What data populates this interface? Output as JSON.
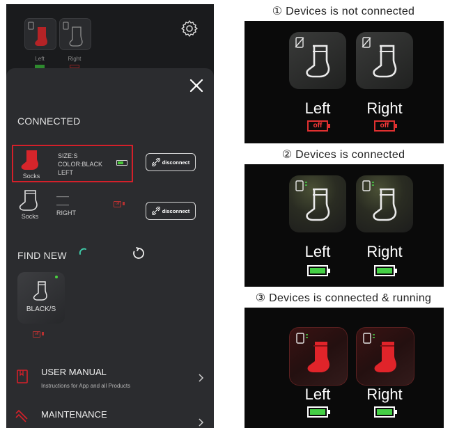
{
  "phone": {
    "top_devices": [
      {
        "label": "Left",
        "status": "connected"
      },
      {
        "label": "Right",
        "status": "off"
      }
    ],
    "connected_title": "CONNECTED",
    "connected_devices": [
      {
        "name": "Socks",
        "line1": "SIZE:S",
        "line2": "COLOR:BLACK",
        "line3": "LEFT",
        "battery": "full",
        "button": "disconnect",
        "selected": true
      },
      {
        "name": "Socks",
        "line1": "——",
        "line2": "——",
        "line3": "RIGHT",
        "battery_tag": "off",
        "button": "disconnect",
        "selected": false
      }
    ],
    "find_new_title": "FIND NEW",
    "new_device": {
      "label": "BLACK/S",
      "tag": "off"
    },
    "menu": [
      {
        "title": "USER MANUAL",
        "subtitle": "Instructions for App and all Products",
        "icon": "book-icon"
      },
      {
        "title": "MAINTENANCE",
        "subtitle": "",
        "icon": "wash-icon"
      }
    ]
  },
  "panels": [
    {
      "caption": "① Devices is not connected",
      "state": "not-connected",
      "left": {
        "label": "Left",
        "battery_text": "off"
      },
      "right": {
        "label": "Right",
        "battery_text": "off"
      }
    },
    {
      "caption": "② Devices is connected",
      "state": "connected",
      "left": {
        "label": "Left"
      },
      "right": {
        "label": "Right"
      }
    },
    {
      "caption": "③ Devices is connected & running",
      "state": "running",
      "left": {
        "label": "Left"
      },
      "right": {
        "label": "Right"
      }
    }
  ],
  "colors": {
    "accent_red": "#d4202a",
    "battery_green": "#45d045",
    "off_red": "#e03030"
  }
}
